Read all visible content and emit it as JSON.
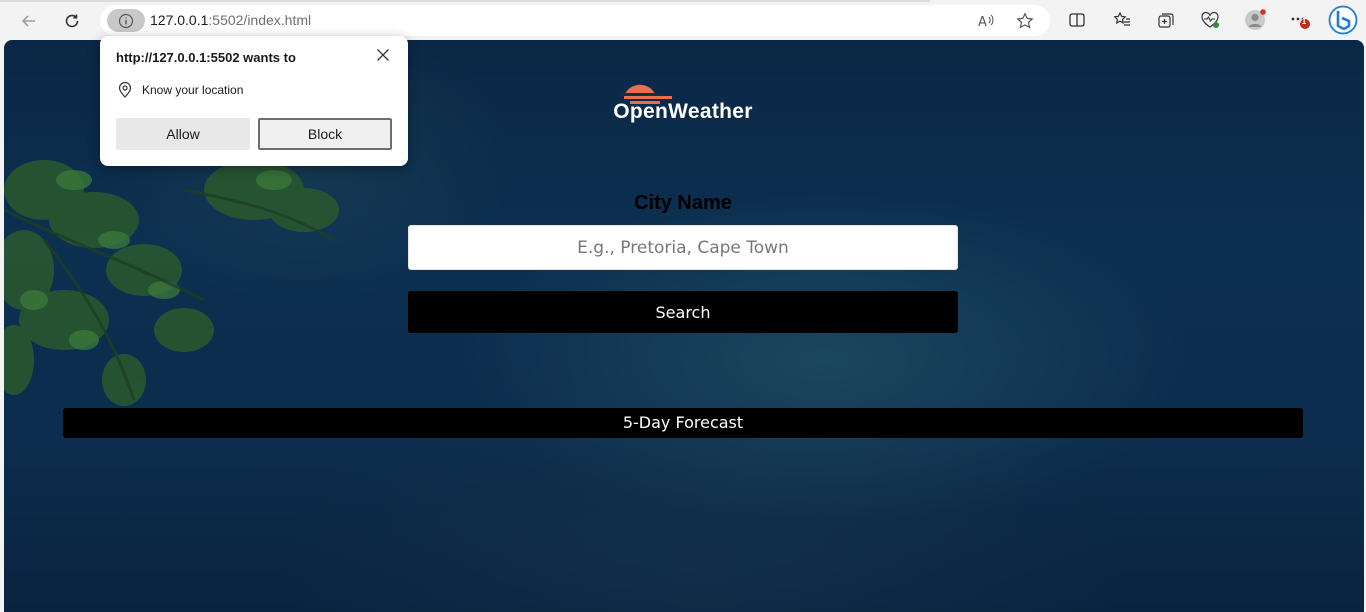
{
  "browser": {
    "url_host": "127.0.0.1",
    "url_rest": ":5502/index.html",
    "notification_badge": "1"
  },
  "popup": {
    "title": "http://127.0.0.1:5502 wants to",
    "permission_text": "Know your location",
    "allow_label": "Allow",
    "block_label": "Block"
  },
  "page": {
    "logo_text": "OpenWeather",
    "city_label": "City Name",
    "search_placeholder": "E.g., Pretoria, Cape Town",
    "search_value": "",
    "search_button": "Search",
    "forecast_title": "5-Day Forecast"
  },
  "colors": {
    "logo_accent": "#e96e50",
    "page_background": "#0c2d4d",
    "button_background": "#000000"
  },
  "icons": [
    "back-icon",
    "refresh-icon",
    "site-info-icon",
    "read-aloud-icon",
    "favorite-star-icon",
    "split-screen-icon",
    "favorites-icon",
    "collections-icon",
    "browser-essentials-icon",
    "profile-icon",
    "more-icon",
    "copilot-icon",
    "location-pin-icon",
    "close-icon"
  ]
}
